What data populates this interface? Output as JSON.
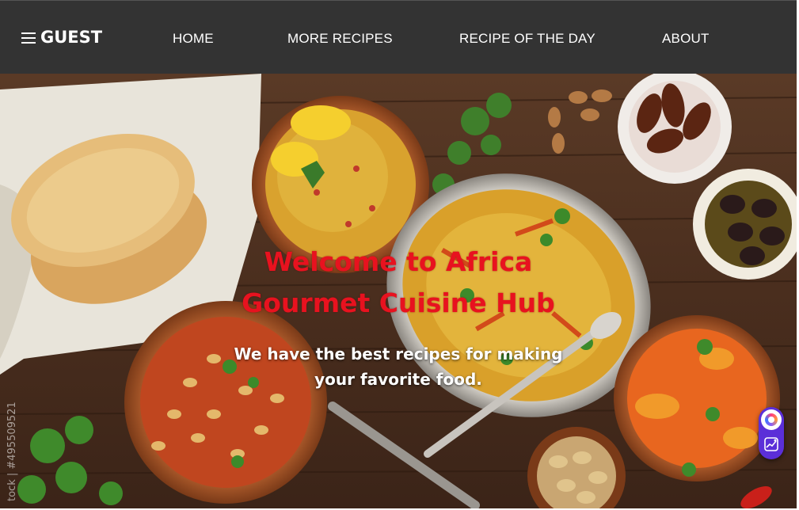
{
  "navbar": {
    "brand_icon": "hamburger-menu-icon",
    "brand_label": "GUEST",
    "links": [
      {
        "label": "HOME"
      },
      {
        "label": "MORE RECIPES"
      },
      {
        "label": "RECIPE OF THE DAY"
      },
      {
        "label": "ABOUT"
      }
    ],
    "background": "#333333"
  },
  "hero": {
    "title_line1": "Welcome to Africa",
    "title_line2": "Gourmet Cuisine Hub",
    "subtitle_line1": "We have the best recipes for making",
    "subtitle_line2": "your favorite food.",
    "title_color": "#e8121f",
    "image_description_icon": "food-spread-image",
    "watermark": "tock | #495509521"
  },
  "widget": {
    "top_icon": "assistant-orb-icon",
    "bottom_icon": "image-chart-icon",
    "color": "#5b2fd8"
  }
}
